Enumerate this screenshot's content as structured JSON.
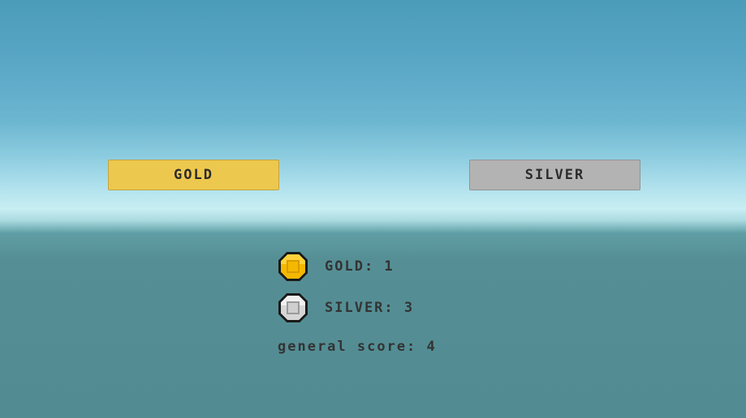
{
  "buttons": {
    "gold_label": "GOLD",
    "silver_label": "SILVER"
  },
  "stats": {
    "gold_label": "GOLD: 1",
    "silver_label": "SILVER: 3",
    "general_score_label": "general score: 4"
  },
  "icons": {
    "gold": "gold-coin-icon",
    "silver": "silver-coin-icon"
  },
  "colors": {
    "gold_button": "#edc84e",
    "silver_button": "#b3b3b3",
    "gold_coin": "#f5b800",
    "silver_coin": "#d6d6d6",
    "text": "#333333"
  }
}
